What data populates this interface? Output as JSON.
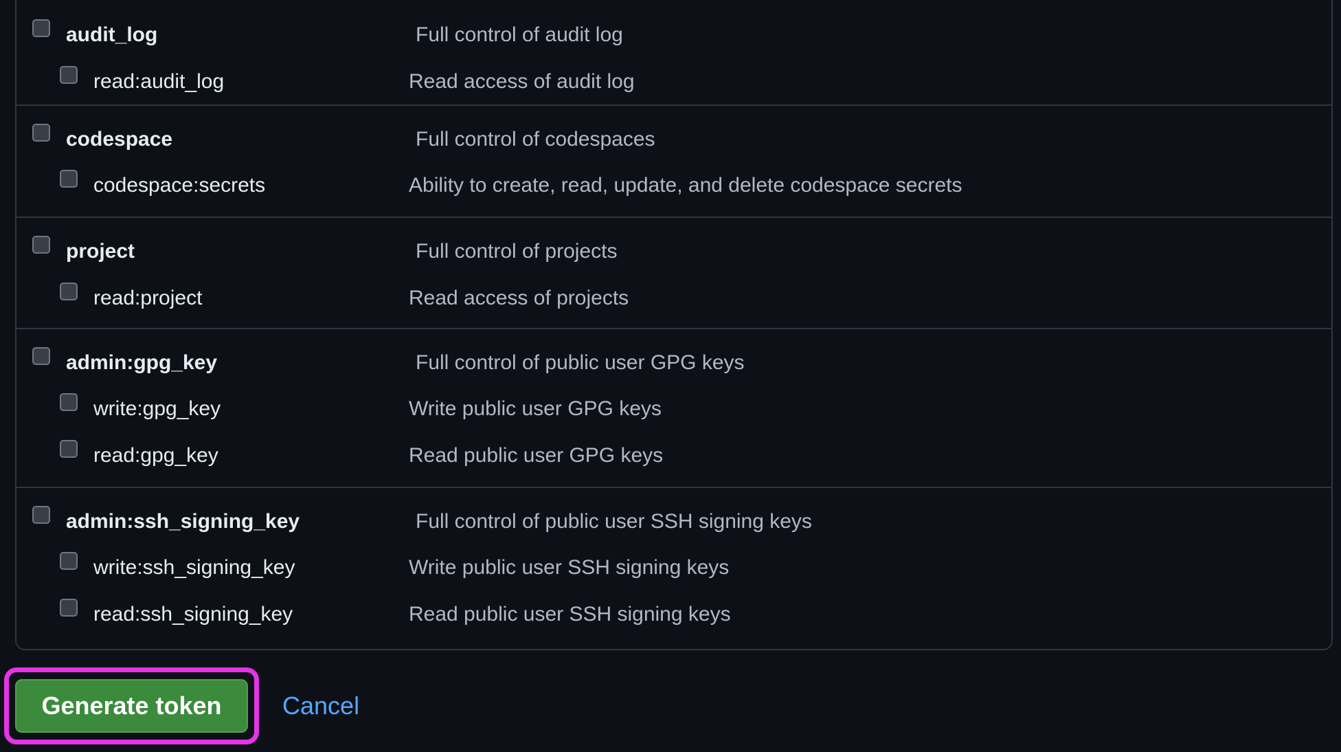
{
  "scopes": {
    "groups": [
      {
        "parent": {
          "name": "audit_log",
          "description": "Full control of audit log"
        },
        "children": [
          {
            "name": "read:audit_log",
            "description": "Read access of audit log"
          }
        ]
      },
      {
        "parent": {
          "name": "codespace",
          "description": "Full control of codespaces"
        },
        "children": [
          {
            "name": "codespace:secrets",
            "description": "Ability to create, read, update, and delete codespace secrets"
          }
        ]
      },
      {
        "parent": {
          "name": "project",
          "description": "Full control of projects"
        },
        "children": [
          {
            "name": "read:project",
            "description": "Read access of projects"
          }
        ]
      },
      {
        "parent": {
          "name": "admin:gpg_key",
          "description": "Full control of public user GPG keys"
        },
        "children": [
          {
            "name": "write:gpg_key",
            "description": "Write public user GPG keys"
          },
          {
            "name": "read:gpg_key",
            "description": "Read public user GPG keys"
          }
        ]
      },
      {
        "parent": {
          "name": "admin:ssh_signing_key",
          "description": "Full control of public user SSH signing keys"
        },
        "children": [
          {
            "name": "write:ssh_signing_key",
            "description": "Write public user SSH signing keys"
          },
          {
            "name": "read:ssh_signing_key",
            "description": "Read public user SSH signing keys"
          }
        ]
      }
    ]
  },
  "actions": {
    "generate_label": "Generate token",
    "cancel_label": "Cancel"
  },
  "colors": {
    "background": "#0d1117",
    "border": "#30363d",
    "primary_button": "#3c8b3d",
    "link": "#58a6ff",
    "highlight": "#e534e5"
  }
}
